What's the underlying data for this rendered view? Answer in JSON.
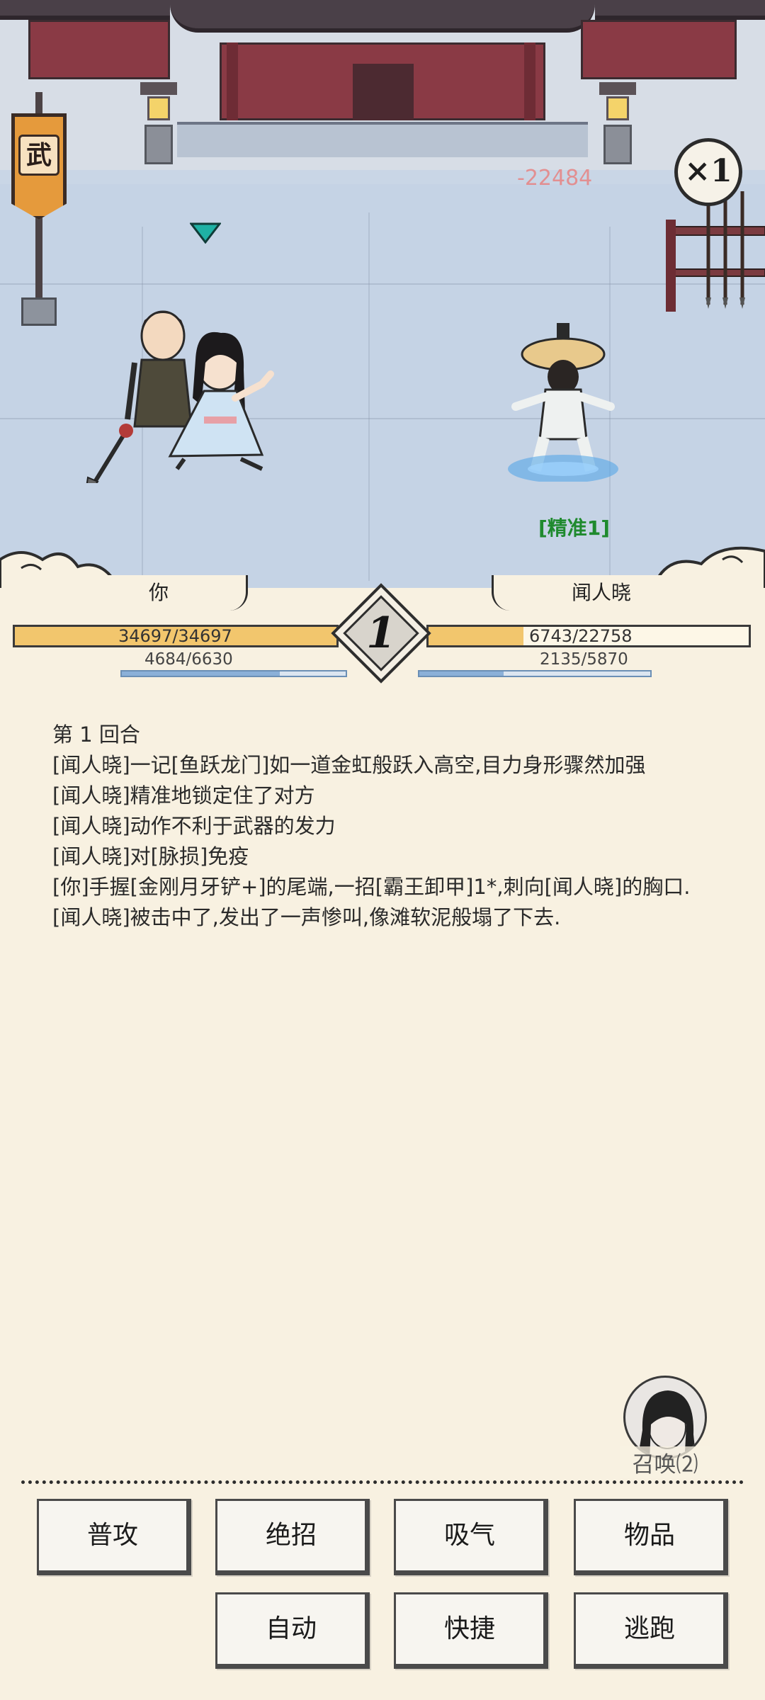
{
  "scene": {
    "banner_glyph": "武",
    "damage_popup": "-22484",
    "speed_multiplier": "×1",
    "status_tag": "[精准1]"
  },
  "player": {
    "name": "你",
    "hp_text": "34697/34697",
    "hp_fraction": 1.0,
    "mp_text": "4684/6630",
    "mp_fraction": 0.706
  },
  "enemy": {
    "name": "闻人晓",
    "hp_text": "6743/22758",
    "hp_fraction": 0.296,
    "mp_text": "2135/5870",
    "mp_fraction": 0.364
  },
  "round": {
    "number": "1"
  },
  "log": {
    "lines": [
      "第 1 回合",
      "[闻人晓]一记[鱼跃龙门]如一道金虹般跃入高空,目力身形骤然加强",
      "[闻人晓]精准地锁定住了对方",
      "[闻人晓]动作不利于武器的发力",
      "[闻人晓]对[脉损]免疫",
      "[你]手握[金刚月牙铲+]的尾端,一招[霸王卸甲]1*,刺向[闻人晓]的胸口.",
      "[闻人晓]被击中了,发出了一声惨叫,像滩软泥般塌了下去."
    ]
  },
  "summon": {
    "label": "召唤⑵"
  },
  "actions": {
    "attack": "普攻",
    "ultimate": "绝招",
    "breathe": "吸气",
    "items": "物品",
    "auto": "自动",
    "quick": "快捷",
    "flee": "逃跑"
  },
  "colors": {
    "hp": "#f2c66d",
    "mp": "#8bb0d8",
    "status_green": "#1f8a2e",
    "paper": "#f8f1e1"
  }
}
